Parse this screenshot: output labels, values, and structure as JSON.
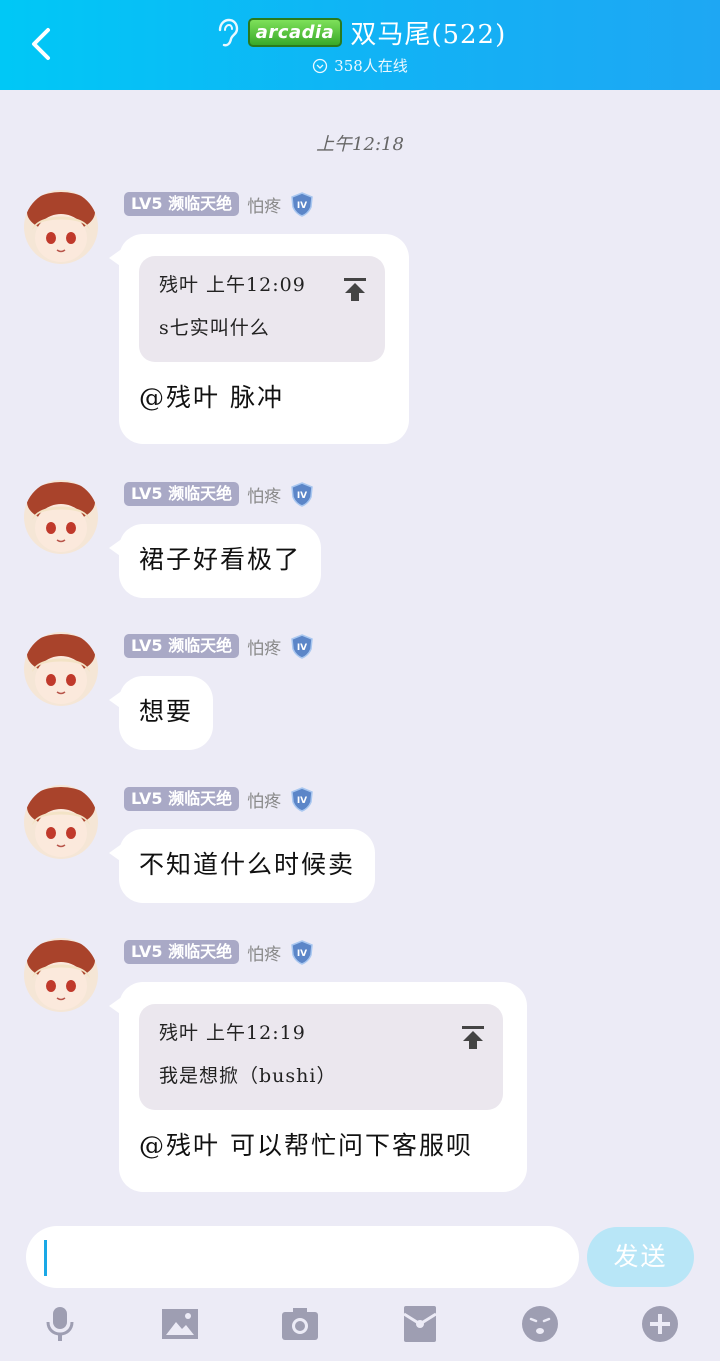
{
  "header": {
    "app_badge": "arcadia",
    "title": "双马尾(522)",
    "online": "358人在线",
    "back_icon": "chevron-left-icon",
    "ear_icon": "ear-icon"
  },
  "timestamp": "上午12:18",
  "messages": [
    {
      "level": "LV5 濒临天绝",
      "user_title": "怕疼",
      "quote": {
        "header": "残叶 上午12:09",
        "body": "s七实叫什么"
      },
      "text": "@残叶 脉冲"
    },
    {
      "level": "LV5 濒临天绝",
      "user_title": "怕疼",
      "text": "裙子好看极了"
    },
    {
      "level": "LV5 濒临天绝",
      "user_title": "怕疼",
      "text": "想要"
    },
    {
      "level": "LV5 濒临天绝",
      "user_title": "怕疼",
      "text": "不知道什么时候卖"
    },
    {
      "level": "LV5 濒临天绝",
      "user_title": "怕疼",
      "quote": {
        "header": "残叶 上午12:19",
        "body": "我是想掀（bushi）"
      },
      "text": "@残叶 可以帮忙问下客服呗"
    }
  ],
  "input": {
    "value": "",
    "send_label": "发送"
  },
  "toolbar": [
    "microphone-icon",
    "image-icon",
    "camera-icon",
    "red-packet-icon",
    "emoji-icon",
    "plus-icon"
  ],
  "colors": {
    "header_start": "#00c8f6",
    "header_end": "#1ea7f3",
    "background": "#ecebf6",
    "send_button": "#b8e6f7",
    "level_badge": "#a9a9c6"
  }
}
